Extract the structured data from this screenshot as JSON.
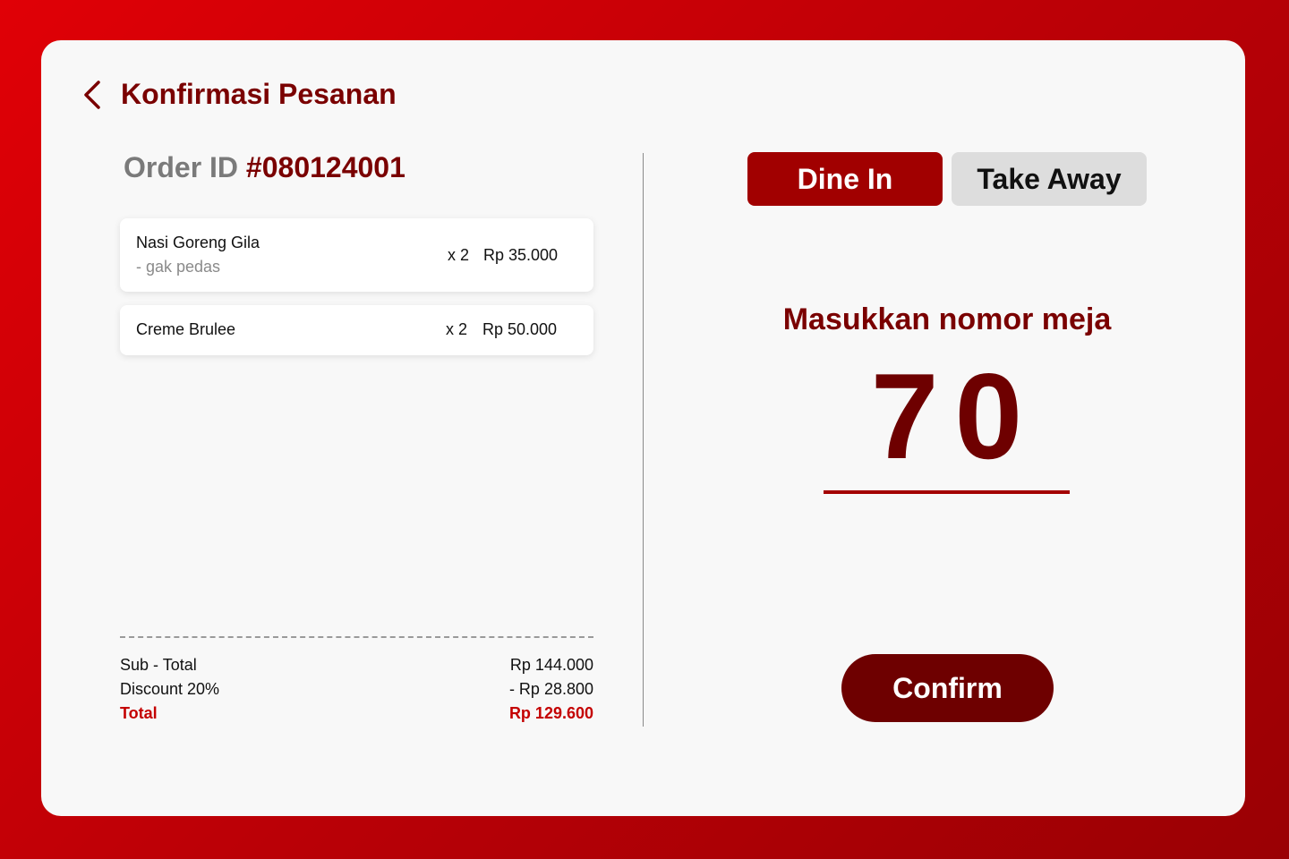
{
  "header": {
    "back_icon": "chevron-left-icon",
    "title": "Konfirmasi Pesanan"
  },
  "order": {
    "id_label": "Order ID",
    "id_value": "#080124001",
    "items": [
      {
        "name": "Nasi Goreng Gila",
        "note": "- gak pedas",
        "qty": "x 2",
        "price": "Rp 35.000"
      },
      {
        "name": "Creme Brulee",
        "qty": "x 2",
        "price": "Rp 50.000"
      }
    ]
  },
  "summary": {
    "subtotal_label": "Sub - Total",
    "subtotal_value": "Rp 144.000",
    "discount_label": "Discount 20%",
    "discount_value": "- Rp 28.800",
    "total_label": "Total",
    "total_value": "Rp 129.600"
  },
  "mode": {
    "dine_in": "Dine In",
    "take_away": "Take Away",
    "selected": "Dine In"
  },
  "table": {
    "prompt": "Masukkan nomor meja",
    "number": "70"
  },
  "actions": {
    "confirm": "Confirm"
  },
  "colors": {
    "brand_dark": "#7a0000",
    "brand_red": "#a10000",
    "total_red": "#c40000",
    "panel_bg": "#f8f8f8"
  }
}
